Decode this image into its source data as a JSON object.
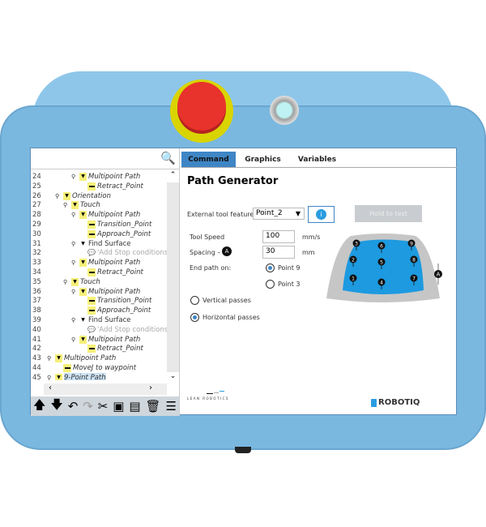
{
  "tree": {
    "rows": [
      {
        "n": "24",
        "lvl": 3,
        "type": "folder",
        "text": "Multipoint Path"
      },
      {
        "n": "25",
        "lvl": 4,
        "type": "bar",
        "text": "Retract_Point"
      },
      {
        "n": "26",
        "lvl": 1,
        "type": "folder",
        "text": "Orientation"
      },
      {
        "n": "27",
        "lvl": 2,
        "type": "folder",
        "text": "Touch"
      },
      {
        "n": "28",
        "lvl": 3,
        "type": "folder",
        "text": "Multipoint Path"
      },
      {
        "n": "29",
        "lvl": 4,
        "type": "bar",
        "text": "Transition_Point"
      },
      {
        "n": "30",
        "lvl": 4,
        "type": "bar",
        "text": "Approach_Point"
      },
      {
        "n": "31",
        "lvl": 3,
        "type": "white",
        "text": "Find Surface"
      },
      {
        "n": "32",
        "lvl": 4,
        "type": "comment",
        "text": "'Add Stop conditions f"
      },
      {
        "n": "33",
        "lvl": 3,
        "type": "folder",
        "text": "Multipoint Path"
      },
      {
        "n": "34",
        "lvl": 4,
        "type": "bar",
        "text": "Retract_Point"
      },
      {
        "n": "35",
        "lvl": 2,
        "type": "folder",
        "text": "Touch"
      },
      {
        "n": "36",
        "lvl": 3,
        "type": "folder",
        "text": "Multipoint Path"
      },
      {
        "n": "37",
        "lvl": 4,
        "type": "bar",
        "text": "Transition_Point"
      },
      {
        "n": "38",
        "lvl": 4,
        "type": "bar",
        "text": "Approach_Point"
      },
      {
        "n": "39",
        "lvl": 3,
        "type": "white",
        "text": "Find Surface"
      },
      {
        "n": "40",
        "lvl": 4,
        "type": "comment",
        "text": "'Add Stop conditions f"
      },
      {
        "n": "41",
        "lvl": 3,
        "type": "folder",
        "text": "Multipoint Path"
      },
      {
        "n": "42",
        "lvl": 4,
        "type": "bar",
        "text": "Retract_Point"
      },
      {
        "n": "43",
        "lvl": 0,
        "type": "folder",
        "text": "Multipoint Path"
      },
      {
        "n": "44",
        "lvl": 1,
        "type": "bar",
        "text": "MoveJ to waypoint"
      },
      {
        "n": "45",
        "lvl": 0,
        "type": "folder",
        "text": "9-Point Path",
        "selected": true
      }
    ]
  },
  "toolbar": [
    "arrow-up",
    "arrow-down",
    "undo",
    "redo",
    "cut",
    "copy",
    "paste",
    "delete",
    "suppress"
  ],
  "tabs": [
    {
      "label": "Command",
      "active": true
    },
    {
      "label": "Graphics"
    },
    {
      "label": "Variables"
    }
  ],
  "panel": {
    "title": "Path Generator",
    "feature_label": "External tool feature",
    "feature_value": "Point_2",
    "hold_label": "Hold to test",
    "speed_label": "Tool Speed",
    "speed_value": "100",
    "speed_unit": "mm/s",
    "spacing_label": "Spacing –",
    "spacing_badge": "A",
    "spacing_value": "30",
    "spacing_unit": "mm",
    "end_label": "End path on:",
    "end_opt1": "Point 9",
    "end_opt2": "Point 3",
    "end_selected": "Point 9",
    "pass_opt1": "Vertical passes",
    "pass_opt2": "Horizontal passes",
    "pass_selected": "Horizontal passes"
  },
  "diagram": {
    "points": [
      "1",
      "2",
      "3",
      "4",
      "5",
      "6",
      "7",
      "8",
      "9"
    ],
    "dim": "A"
  },
  "footer": {
    "lean": "LEAN ROBOTICS",
    "brand": "ROBOTIQ"
  },
  "colors": {
    "accent": "#3f86c6",
    "body": "#7ab8e0",
    "estop": "#e8322c"
  }
}
